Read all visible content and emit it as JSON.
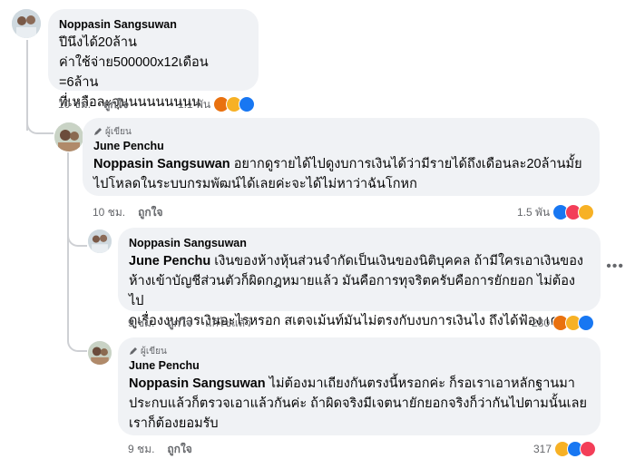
{
  "comments": [
    {
      "author": "Noppasin Sangsuwan",
      "lines": [
        "ปีนึงได้20ล้าน",
        "ค่าใช้จ่าย500000x12เดือน =6ล้าน",
        "ที่เหลือละจุนนนนนนนนน"
      ],
      "time": "10 ชม.",
      "like": "ถูกใจ",
      "count": "1.1 พัน",
      "reactions": [
        "angry-icon",
        "haha-icon",
        "like-icon"
      ]
    },
    {
      "badge": "ผู้เขียน",
      "author": "June Penchu",
      "mention": "Noppasin Sangsuwan",
      "line1": " อยากดูรายได้ไปดูงบการเงินได้ว่ามีรายได้ถึงเดือนละ20ล้านมั้ย",
      "line2": "ไปโหลดในระบบกรมพัฒน์ได้เลยค่ะจะได้ไม่หาว่าฉันโกหก",
      "time": "10 ชม.",
      "like": "ถูกใจ",
      "count": "1.5 พัน",
      "reactions": [
        "like-icon",
        "love-icon",
        "care-icon"
      ]
    },
    {
      "author": "Noppasin Sangsuwan",
      "mention": "June Penchu",
      "line1": " เงินของห้างหุ้นส่วนจำกัดเป็นเงินของนิติบุคคล ถ้ามีใครเอาเงินของ",
      "line2": "ห้างเข้าบัญชีส่วนตัวก็ผิดกฎหมายแล้ว มันคือการทุจริตครับคือการยักยอก ไม่ต้องไป",
      "line3": "ดูเรื่องงบการเงินอะไรหรอก สเตจเม้นท์มันไม่ตรงกับงบการเงินไง ถึงได้ฟ้อง เคนะ",
      "time": "9 ชม.",
      "like": "ถูกใจ",
      "edited": "แก้ไขแล้ว",
      "count": "280",
      "reactions": [
        "angry-icon",
        "haha-icon",
        "like-icon"
      ]
    },
    {
      "badge": "ผู้เขียน",
      "author": "June Penchu",
      "mention": "Noppasin Sangsuwan",
      "line1": " ไม่ต้องมาเถียงกันตรงนี้หรอกค่ะ ก็รอเราเอาหลักฐานมา",
      "line2": "ประกบแล้วก็ตรวจเอาแล้วกันค่ะ ถ้าผิดจริงมีเจตนายักยอกจริงก็ว่ากันไปตามนั้นเลย",
      "line3": "เราก็ต้องยอมรับ",
      "time": "9 ชม.",
      "like": "ถูกใจ",
      "count": "317",
      "reactions": [
        "haha-icon",
        "like-icon",
        "love-icon"
      ]
    }
  ],
  "colors": {
    "bubble": "#f0f2f5",
    "meta": "#65676b",
    "like": "#1877f2",
    "angry": "#e9710f",
    "haha": "#f7b125",
    "love": "#f33e58"
  },
  "menu_icon": "more-options-icon"
}
